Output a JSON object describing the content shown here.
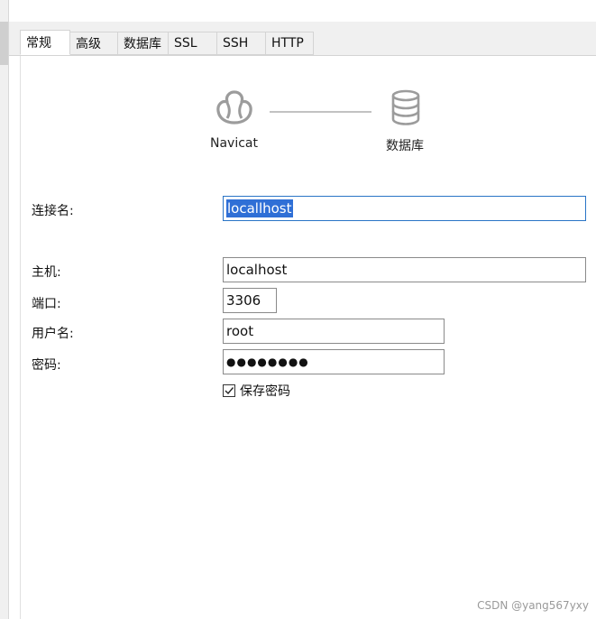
{
  "tabs": [
    {
      "label": "常规",
      "active": true
    },
    {
      "label": "高级",
      "active": false
    },
    {
      "label": "数据库",
      "active": false
    },
    {
      "label": "SSL",
      "active": false
    },
    {
      "label": "SSH",
      "active": false
    },
    {
      "label": "HTTP",
      "active": false
    }
  ],
  "diagram": {
    "left_label": "Navicat",
    "left_icon": "navicat-logo-icon",
    "right_label": "数据库",
    "right_icon": "database-icon"
  },
  "form": {
    "connection_name": {
      "label": "连接名:",
      "value": "locallhost"
    },
    "host": {
      "label": "主机:",
      "value": "localhost"
    },
    "port": {
      "label": "端口:",
      "value": "3306"
    },
    "username": {
      "label": "用户名:",
      "value": "root"
    },
    "password": {
      "label": "密码:",
      "value": "●●●●●●●●"
    },
    "save_password": {
      "label": "保存密码",
      "checked": true
    }
  },
  "watermark": "CSDN @yang567yxy",
  "colors": {
    "focus_border": "#2a74c6",
    "selection": "#2f6fd6",
    "tab_bar": "#f0f0f0"
  }
}
